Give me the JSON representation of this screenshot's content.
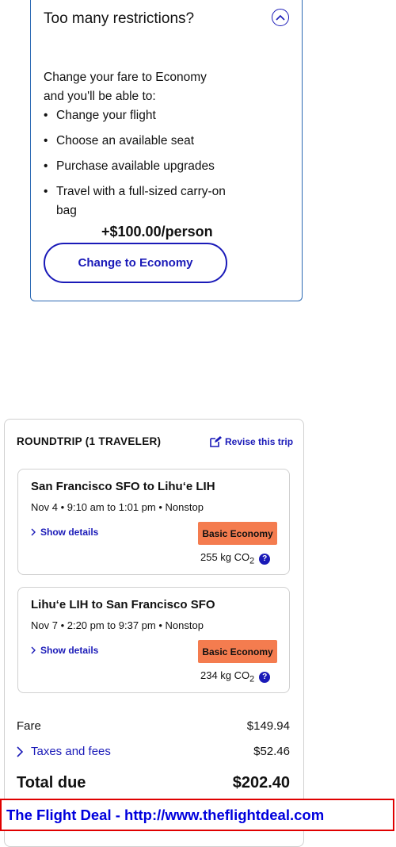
{
  "restrictions": {
    "title": "Too many restrictions?",
    "description": "Change your fare to Economy and you'll be able to:",
    "benefits": [
      "Change your flight",
      "Choose an available seat",
      "Purchase available upgrades",
      "Travel with a full-sized carry-on bag"
    ],
    "upgrade_price": "+$100.00/person",
    "button_label": "Change to Economy"
  },
  "trip": {
    "heading": "ROUNDTRIP (1 TRAVELER)",
    "revise_label": "Revise this trip",
    "legs": [
      {
        "route": "San Francisco SFO to Lihu‘e LIH",
        "times": "Nov 4 • 9:10 am to 1:01 pm • Nonstop",
        "details_label": "Show details",
        "fare_class": "Basic Economy",
        "co2_value": "255 kg CO",
        "co2_sub": "2"
      },
      {
        "route": "Lihu‘e LIH to San Francisco SFO",
        "times": "Nov 7 • 2:20 pm to 9:37 pm • Nonstop",
        "details_label": "Show details",
        "fare_class": "Basic Economy",
        "co2_value": "234 kg CO",
        "co2_sub": "2"
      }
    ],
    "fare_label": "Fare",
    "fare_amount": "$149.94",
    "taxes_label": "Taxes and fees",
    "taxes_amount": "$52.46",
    "total_label": "Total due",
    "total_amount": "$202.40"
  },
  "watermark": "The Flight Deal - http://www.theflightdeal.com",
  "colors": {
    "accent": "#1a1ab8",
    "panel_border": "#2d6ab4",
    "badge": "#f47c4f",
    "watermark_border": "#e00000",
    "watermark_text": "#0000dd"
  },
  "icons": {
    "collapse": "chevron-up-circle-icon",
    "revise": "edit-icon",
    "details": "chevron-right-icon",
    "info": "question-icon",
    "taxes": "chevron-right-icon"
  }
}
